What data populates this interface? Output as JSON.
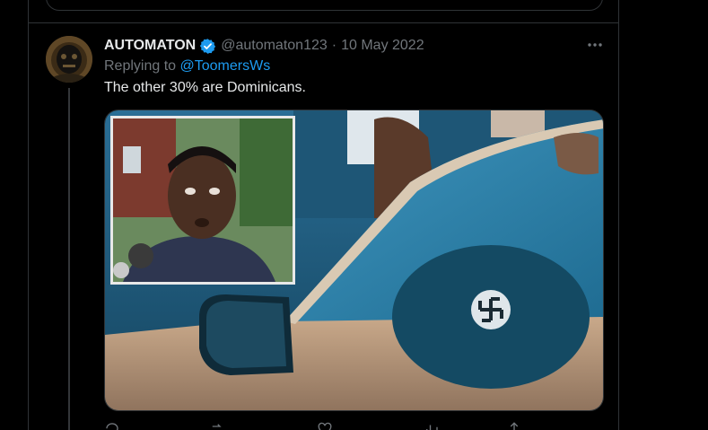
{
  "tweet": {
    "author_name": "AUTOMATON",
    "handle": "@automaton123",
    "separator": "·",
    "date": "10 May 2022",
    "replying_to_label": "Replying to",
    "replying_to_mention": "@ToomersWs",
    "text": "The other 30% are Dominicans."
  },
  "icons": {
    "verified": "verified-badge-icon",
    "more": "more-options-icon",
    "reply": "reply-icon",
    "retweet": "retweet-icon",
    "like": "like-icon",
    "views": "views-icon",
    "share": "share-icon"
  },
  "colors": {
    "background": "#000000",
    "text": "#e7e9ea",
    "secondary": "#71767b",
    "accent": "#1d9bf0",
    "border": "#2f3336"
  }
}
